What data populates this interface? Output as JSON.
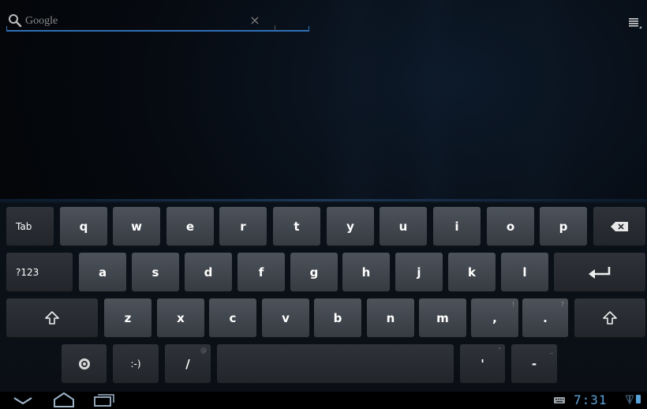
{
  "search": {
    "placeholder": "Google",
    "value": "",
    "clear_glyph": "×"
  },
  "icons": {
    "search": "search-icon",
    "clear": "close-icon",
    "menu": "menu-icon",
    "back": "back-icon",
    "home": "home-icon",
    "recent": "recent-apps-icon",
    "keyboard_status": "keyboard-icon",
    "signal": "signal-icon",
    "battery": "battery-icon",
    "shift": "shift-icon",
    "delete": "backspace-icon",
    "enter": "enter-icon",
    "settings": "settings-icon"
  },
  "keyboard": {
    "row1": {
      "tab": "Tab",
      "letters": [
        "q",
        "w",
        "e",
        "r",
        "t",
        "y",
        "u",
        "i",
        "o",
        "p"
      ]
    },
    "row2": {
      "symbols": "?123",
      "letters": [
        "a",
        "s",
        "d",
        "f",
        "g",
        "h",
        "j",
        "k",
        "l"
      ]
    },
    "row3": {
      "letters": [
        "z",
        "x",
        "c",
        "v",
        "b",
        "n",
        "m"
      ],
      "comma": ",",
      "comma_hint": "!",
      "period": ".",
      "period_hint": "?"
    },
    "row4": {
      "smiley": ":-)",
      "slash": "/",
      "slash_hint": "@",
      "apostrophe": "'",
      "apostrophe_hint": "\"",
      "dash": "-",
      "dash_hint": "_",
      "space": ""
    }
  },
  "status": {
    "time": "7:31"
  },
  "colors": {
    "accent": "#2f6fb5",
    "clock": "#5aa3d8",
    "key": "#43484f",
    "key_dark": "#2a2e33"
  }
}
